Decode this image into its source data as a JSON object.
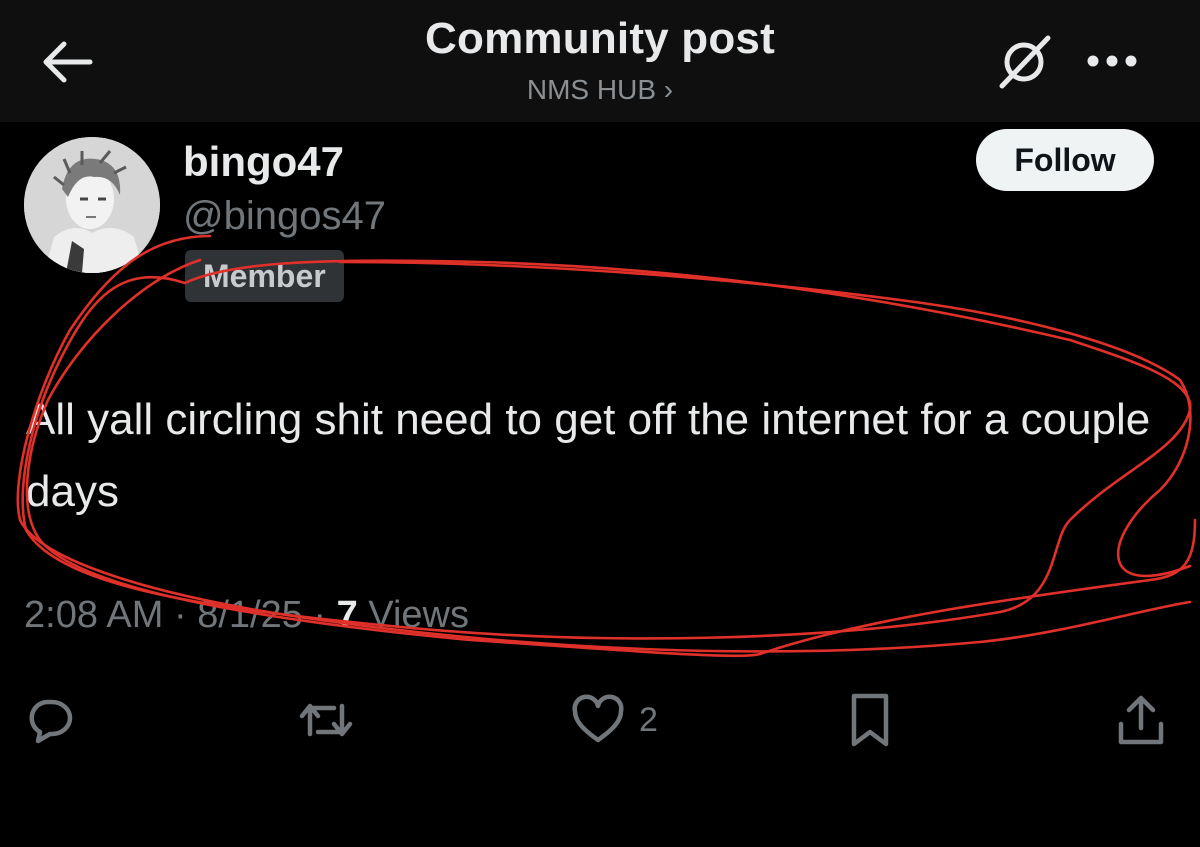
{
  "header": {
    "title": "Community post",
    "subtitle": "NMS HUB ›",
    "back_icon": "arrow-left-icon",
    "mute_icon": "grok-icon",
    "more_icon": "more-dots-icon"
  },
  "post": {
    "display_name": "bingo47",
    "handle": "@bingos47",
    "badge": "Member",
    "follow_label": "Follow",
    "text": "All yall circling shit need to get off the internet for a couple days",
    "meta_prefix": "2:08 AM · 8/1/25 · ",
    "views_count": "7",
    "views_label": " Views"
  },
  "actions": {
    "reply_icon": "reply-icon",
    "repost_icon": "repost-icon",
    "like_icon": "heart-icon",
    "like_count": "2",
    "bookmark_icon": "bookmark-icon",
    "share_icon": "share-icon"
  },
  "colors": {
    "background": "#000000",
    "header_bg": "#0f0f0f",
    "text": "#e7e9ea",
    "muted": "#71767b",
    "annotation": "#e0302a"
  }
}
